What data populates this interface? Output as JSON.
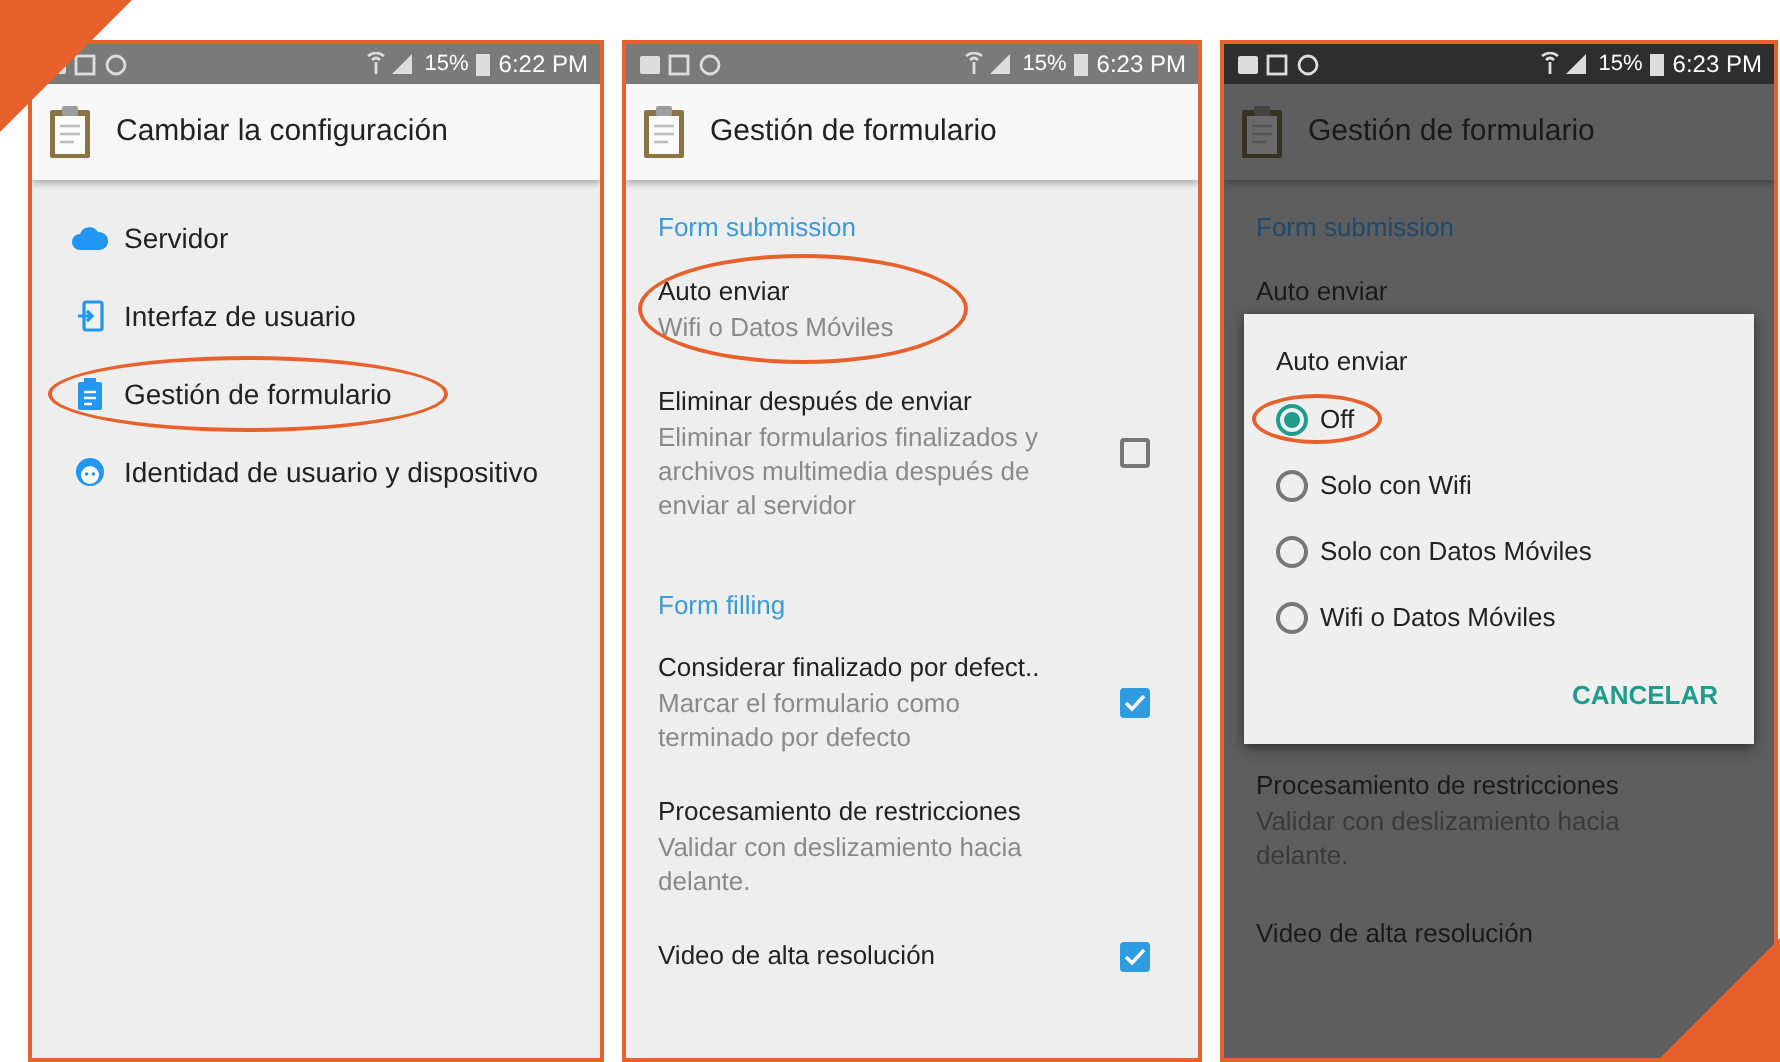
{
  "panels": [
    {
      "kind": "menu",
      "status_bar": {
        "battery": "15%",
        "time": "6:22 PM"
      },
      "title": "Cambiar la configuración",
      "items": [
        {
          "label": "Servidor",
          "circled": false
        },
        {
          "label": "Interfaz de usuario",
          "circled": false
        },
        {
          "label": "Gestión de formulario",
          "circled": true
        },
        {
          "label": "Identidad de usuario y dispositivo",
          "circled": false
        }
      ]
    },
    {
      "kind": "settings",
      "status_bar": {
        "battery": "15%",
        "time": "6:23 PM"
      },
      "title": "Gestión de formulario",
      "sections": [
        {
          "header": "Form submission",
          "items": [
            {
              "kind": "text",
              "title": "Auto enviar",
              "summary": "Wifi o Datos Móviles",
              "circled": true
            },
            {
              "kind": "checkbox",
              "title": "Eliminar después de enviar",
              "summary": "Eliminar formularios finalizados y archivos multimedia después de enviar al servidor",
              "checked": false,
              "circled": false
            }
          ]
        },
        {
          "header": "Form filling",
          "items": [
            {
              "kind": "checkbox",
              "title": "Considerar finalizado por defect..",
              "summary": "Marcar el formulario como terminado por defecto",
              "checked": true,
              "circled": false
            },
            {
              "kind": "text",
              "title": "Procesamiento de restricciones",
              "summary": "Validar con deslizamiento hacia delante.",
              "circled": false
            },
            {
              "kind": "checkbox",
              "title": "Video de alta resolución",
              "checked": true,
              "circled": false
            }
          ]
        }
      ]
    },
    {
      "kind": "dialog",
      "status_bar": {
        "battery": "15%",
        "time": "6:23 PM"
      },
      "title": "Gestión de formulario",
      "header": "Form submission",
      "above": [
        {
          "title": "Auto enviar"
        }
      ],
      "dialog": {
        "title": "Auto enviar",
        "options": [
          {
            "label": "Off",
            "selected": true,
            "circled": true
          },
          {
            "label": "Solo con Wifi",
            "selected": false,
            "circled": false
          },
          {
            "label": "Solo con Datos Móviles",
            "selected": false,
            "circled": false
          },
          {
            "label": "Wifi o Datos Móviles",
            "selected": false,
            "circled": false
          }
        ],
        "button": "CANCELAR"
      },
      "below": [
        {
          "title": "Procesamiento de restricciones",
          "summary": "Validar con deslizamiento hacia delante."
        },
        {
          "title": "Video de alta resolución"
        }
      ]
    }
  ]
}
